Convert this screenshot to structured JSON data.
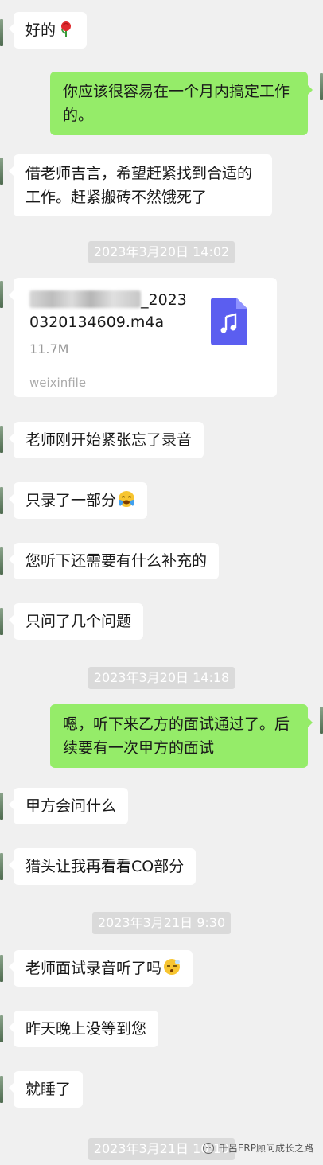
{
  "messages": {
    "m1": "好的",
    "m2": "你应该很容易在一个月内搞定工作的。",
    "m3": "借老师吉言，希望赶紧找到合适的工作。赶紧搬砖不然饿死了",
    "m5": "老师刚开始紧张忘了录音",
    "m6": "只录了一部分",
    "m7": "您听下还需要有什么补充的",
    "m8": "只问了几个问题",
    "m9": "嗯，听下来乙方的面试通过了。后续要有一次甲方的面试",
    "m10": "甲方会问什么",
    "m11": "猎头让我再看看CO部分",
    "m12": "老师面试录音听了吗",
    "m13": "昨天晚上没等到您",
    "m14": "就睡了"
  },
  "file": {
    "name_tail": "_2023",
    "name_line2": "0320134609.m4a",
    "size": "11.7M",
    "source": "weixinfile",
    "icon": "music-file-icon",
    "icon_color": "#5b5ef0"
  },
  "timestamps": {
    "t1": "2023年3月20日 14:02",
    "t2": "2023年3月20日 14:18",
    "t3": "2023年3月21日 9:30",
    "t4": "2023年3月21日 10:10"
  },
  "watermark": {
    "text": "千呂ERP顾问成长之路"
  },
  "colors": {
    "background": "#f0f0f0",
    "incoming_bubble": "#ffffff",
    "outgoing_bubble": "#95ec69",
    "timestamp_bg": "#dadada"
  },
  "emojis": {
    "rose": "rose-icon",
    "crying": "crying-face-icon",
    "sleepy": "sleepy-face-icon"
  }
}
